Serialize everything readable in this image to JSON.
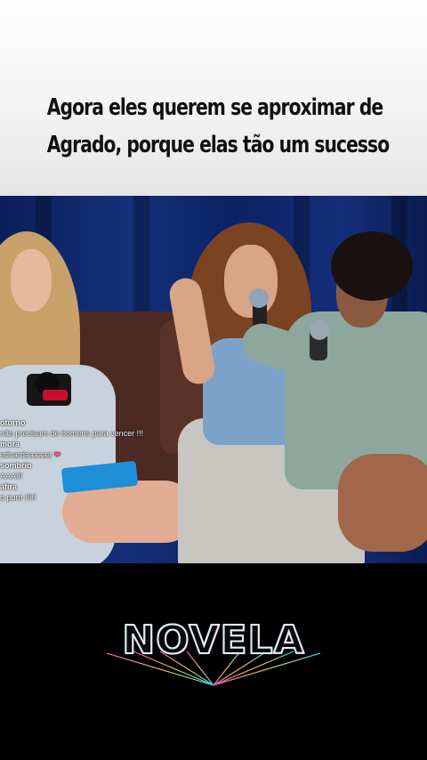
{
  "caption": {
    "line1": "Agora eles querem se aproximar de",
    "line2": "Agrado, porque elas tão um sucesso"
  },
  "live_chat": [
    {
      "user": "oturno",
      "text": "não precisam de homens para vencer !!!"
    },
    {
      "user": "mora",
      "text": "eduardaaaaaa",
      "emoji": "heart"
    },
    {
      "user": "sombrio",
      "text": "AAA!!!"
    },
    {
      "user": "afira",
      "text": "o puro !!!!!"
    }
  ],
  "logo": {
    "text": "NOVELA"
  },
  "colors": {
    "accent_pink": "#ff6ad5",
    "accent_cyan": "#4be3ff",
    "heart": "#ff4f86"
  }
}
